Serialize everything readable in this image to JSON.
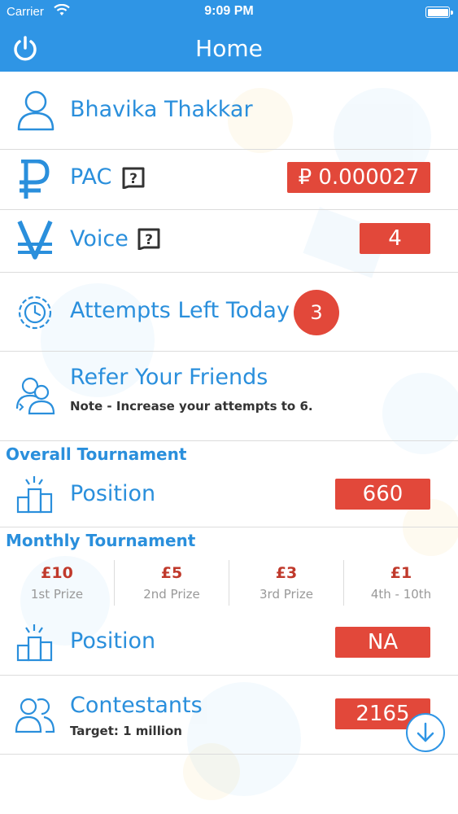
{
  "status_bar": {
    "carrier": "Carrier",
    "time": "9:09 PM"
  },
  "header": {
    "title": "Home",
    "power_icon": "power-icon"
  },
  "profile": {
    "name": "Bhavika Thakkar",
    "icon": "user-icon"
  },
  "pac": {
    "label": "PAC",
    "value": "₽ 0.000027",
    "icon": "ruble-icon",
    "help_icon": "question-icon"
  },
  "voice": {
    "label": "Voice",
    "value": "4",
    "icon": "yen-icon",
    "help_icon": "question-icon"
  },
  "attempts": {
    "label": "Attempts Left Today",
    "value": "3",
    "icon": "clock-icon"
  },
  "refer": {
    "label": "Refer Your Friends",
    "note": "Note - Increase your attempts to 6.",
    "icon": "friends-icon"
  },
  "overall": {
    "section_title": "Overall Tournament",
    "position_label": "Position",
    "position_value": "660",
    "icon": "podium-icon"
  },
  "monthly": {
    "section_title": "Monthly Tournament",
    "prizes": [
      {
        "amount": "£10",
        "label": "1st Prize"
      },
      {
        "amount": "£5",
        "label": "2nd Prize"
      },
      {
        "amount": "£3",
        "label": "3rd Prize"
      },
      {
        "amount": "£1",
        "label": "4th - 10th"
      }
    ],
    "position_label": "Position",
    "position_value": "NA",
    "icon": "podium-icon"
  },
  "contestants": {
    "label": "Contestants",
    "note": "Target: 1 million",
    "value": "2165",
    "icon": "contestants-icon"
  },
  "scroll_down": {
    "icon": "arrow-down-icon"
  },
  "colors": {
    "primary": "#2f95e5",
    "accent_red": "#e2483a",
    "text_blue": "#2a8fdc"
  }
}
